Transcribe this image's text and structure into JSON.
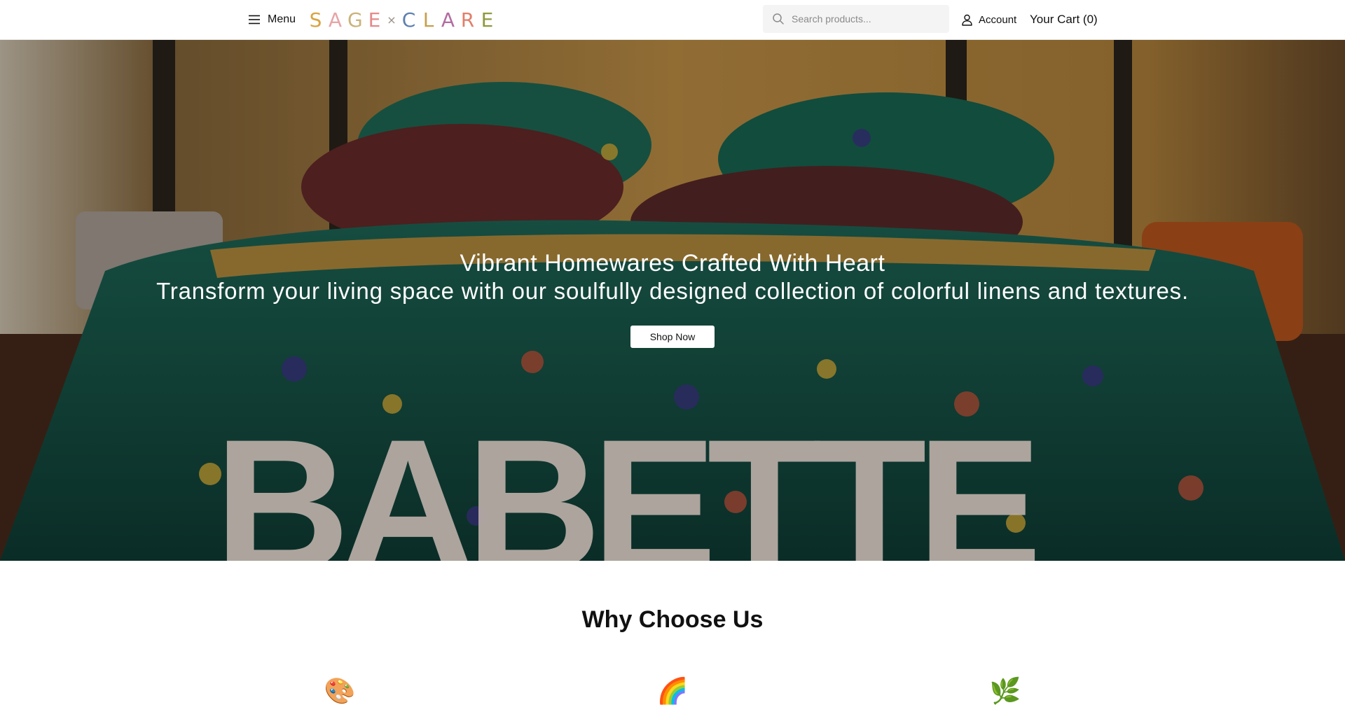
{
  "header": {
    "menu_label": "Menu",
    "logo_letters_left": [
      "S",
      "A",
      "G",
      "E"
    ],
    "logo_separator": "×",
    "logo_letters_right": [
      "C",
      "L",
      "A",
      "R",
      "E"
    ],
    "logo_colors": [
      "#d9a441",
      "#e7a5a8",
      "#c9b37a",
      "#e58a8a",
      "#5f7fb0",
      "#c89f4b",
      "#b26da1",
      "#e07f6a",
      "#8f9a3b"
    ],
    "search_placeholder": "Search products...",
    "account_label": "Account",
    "cart_label": "Your Cart (0)"
  },
  "hero": {
    "title": "Vibrant Homewares Crafted With Heart",
    "subtitle": "Transform your living space with our soulfully designed collection of colorful linens and textures.",
    "cta_label": "Shop Now",
    "background_word": "BABETTE"
  },
  "why": {
    "title": "Why Choose Us",
    "features": [
      {
        "icon": "🎨",
        "icon_name": "palette-icon"
      },
      {
        "icon": "🌈",
        "icon_name": "rainbow-icon"
      },
      {
        "icon": "🌿",
        "icon_name": "herb-icon"
      }
    ]
  }
}
